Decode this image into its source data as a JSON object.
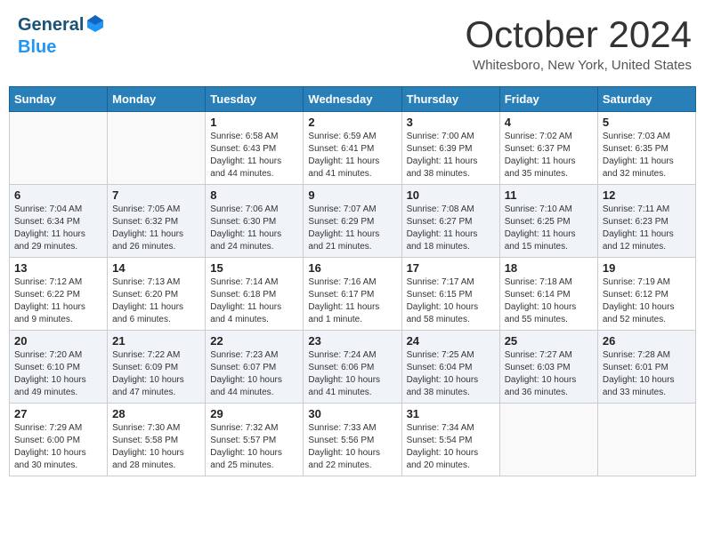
{
  "header": {
    "logo_general": "General",
    "logo_blue": "Blue",
    "title": "October 2024",
    "location": "Whitesboro, New York, United States"
  },
  "weekdays": [
    "Sunday",
    "Monday",
    "Tuesday",
    "Wednesday",
    "Thursday",
    "Friday",
    "Saturday"
  ],
  "weeks": [
    [
      {
        "day": "",
        "info": ""
      },
      {
        "day": "",
        "info": ""
      },
      {
        "day": "1",
        "info": "Sunrise: 6:58 AM\nSunset: 6:43 PM\nDaylight: 11 hours and 44 minutes."
      },
      {
        "day": "2",
        "info": "Sunrise: 6:59 AM\nSunset: 6:41 PM\nDaylight: 11 hours and 41 minutes."
      },
      {
        "day": "3",
        "info": "Sunrise: 7:00 AM\nSunset: 6:39 PM\nDaylight: 11 hours and 38 minutes."
      },
      {
        "day": "4",
        "info": "Sunrise: 7:02 AM\nSunset: 6:37 PM\nDaylight: 11 hours and 35 minutes."
      },
      {
        "day": "5",
        "info": "Sunrise: 7:03 AM\nSunset: 6:35 PM\nDaylight: 11 hours and 32 minutes."
      }
    ],
    [
      {
        "day": "6",
        "info": "Sunrise: 7:04 AM\nSunset: 6:34 PM\nDaylight: 11 hours and 29 minutes."
      },
      {
        "day": "7",
        "info": "Sunrise: 7:05 AM\nSunset: 6:32 PM\nDaylight: 11 hours and 26 minutes."
      },
      {
        "day": "8",
        "info": "Sunrise: 7:06 AM\nSunset: 6:30 PM\nDaylight: 11 hours and 24 minutes."
      },
      {
        "day": "9",
        "info": "Sunrise: 7:07 AM\nSunset: 6:29 PM\nDaylight: 11 hours and 21 minutes."
      },
      {
        "day": "10",
        "info": "Sunrise: 7:08 AM\nSunset: 6:27 PM\nDaylight: 11 hours and 18 minutes."
      },
      {
        "day": "11",
        "info": "Sunrise: 7:10 AM\nSunset: 6:25 PM\nDaylight: 11 hours and 15 minutes."
      },
      {
        "day": "12",
        "info": "Sunrise: 7:11 AM\nSunset: 6:23 PM\nDaylight: 11 hours and 12 minutes."
      }
    ],
    [
      {
        "day": "13",
        "info": "Sunrise: 7:12 AM\nSunset: 6:22 PM\nDaylight: 11 hours and 9 minutes."
      },
      {
        "day": "14",
        "info": "Sunrise: 7:13 AM\nSunset: 6:20 PM\nDaylight: 11 hours and 6 minutes."
      },
      {
        "day": "15",
        "info": "Sunrise: 7:14 AM\nSunset: 6:18 PM\nDaylight: 11 hours and 4 minutes."
      },
      {
        "day": "16",
        "info": "Sunrise: 7:16 AM\nSunset: 6:17 PM\nDaylight: 11 hours and 1 minute."
      },
      {
        "day": "17",
        "info": "Sunrise: 7:17 AM\nSunset: 6:15 PM\nDaylight: 10 hours and 58 minutes."
      },
      {
        "day": "18",
        "info": "Sunrise: 7:18 AM\nSunset: 6:14 PM\nDaylight: 10 hours and 55 minutes."
      },
      {
        "day": "19",
        "info": "Sunrise: 7:19 AM\nSunset: 6:12 PM\nDaylight: 10 hours and 52 minutes."
      }
    ],
    [
      {
        "day": "20",
        "info": "Sunrise: 7:20 AM\nSunset: 6:10 PM\nDaylight: 10 hours and 49 minutes."
      },
      {
        "day": "21",
        "info": "Sunrise: 7:22 AM\nSunset: 6:09 PM\nDaylight: 10 hours and 47 minutes."
      },
      {
        "day": "22",
        "info": "Sunrise: 7:23 AM\nSunset: 6:07 PM\nDaylight: 10 hours and 44 minutes."
      },
      {
        "day": "23",
        "info": "Sunrise: 7:24 AM\nSunset: 6:06 PM\nDaylight: 10 hours and 41 minutes."
      },
      {
        "day": "24",
        "info": "Sunrise: 7:25 AM\nSunset: 6:04 PM\nDaylight: 10 hours and 38 minutes."
      },
      {
        "day": "25",
        "info": "Sunrise: 7:27 AM\nSunset: 6:03 PM\nDaylight: 10 hours and 36 minutes."
      },
      {
        "day": "26",
        "info": "Sunrise: 7:28 AM\nSunset: 6:01 PM\nDaylight: 10 hours and 33 minutes."
      }
    ],
    [
      {
        "day": "27",
        "info": "Sunrise: 7:29 AM\nSunset: 6:00 PM\nDaylight: 10 hours and 30 minutes."
      },
      {
        "day": "28",
        "info": "Sunrise: 7:30 AM\nSunset: 5:58 PM\nDaylight: 10 hours and 28 minutes."
      },
      {
        "day": "29",
        "info": "Sunrise: 7:32 AM\nSunset: 5:57 PM\nDaylight: 10 hours and 25 minutes."
      },
      {
        "day": "30",
        "info": "Sunrise: 7:33 AM\nSunset: 5:56 PM\nDaylight: 10 hours and 22 minutes."
      },
      {
        "day": "31",
        "info": "Sunrise: 7:34 AM\nSunset: 5:54 PM\nDaylight: 10 hours and 20 minutes."
      },
      {
        "day": "",
        "info": ""
      },
      {
        "day": "",
        "info": ""
      }
    ]
  ]
}
